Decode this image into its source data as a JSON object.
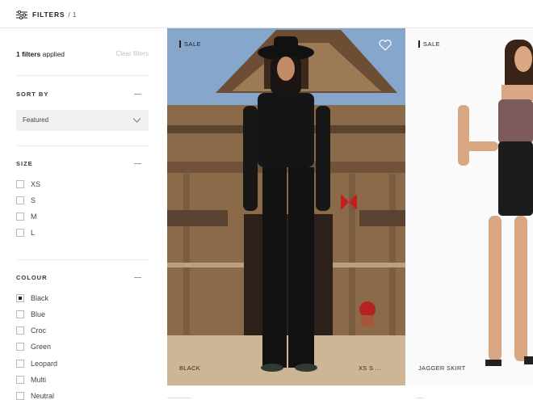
{
  "topbar": {
    "filters_label": "FILTERS",
    "separator": "/",
    "count": "1"
  },
  "sidebar": {
    "applied_count": "1 filters",
    "applied_suffix": "applied",
    "clear_label": "Clear filters",
    "sort": {
      "title": "SORT BY",
      "selected": "Featured"
    },
    "size": {
      "title": "SIZE",
      "options": [
        "XS",
        "S",
        "M",
        "L"
      ]
    },
    "colour": {
      "title": "COLOUR",
      "options": [
        {
          "label": "Black",
          "checked": true
        },
        {
          "label": "Blue",
          "checked": false
        },
        {
          "label": "Croc",
          "checked": false
        },
        {
          "label": "Green",
          "checked": false
        },
        {
          "label": "Leopard",
          "checked": false
        },
        {
          "label": "Multi",
          "checked": false
        },
        {
          "label": "Neutral",
          "checked": false
        }
      ]
    }
  },
  "products": [
    {
      "badge": "SALE",
      "caption": "BLACK",
      "sizes": "XS  S  ...",
      "wishlist_icon": "heart-icon"
    },
    {
      "badge": "SALE",
      "caption": "JAGGER SKIRT"
    }
  ]
}
